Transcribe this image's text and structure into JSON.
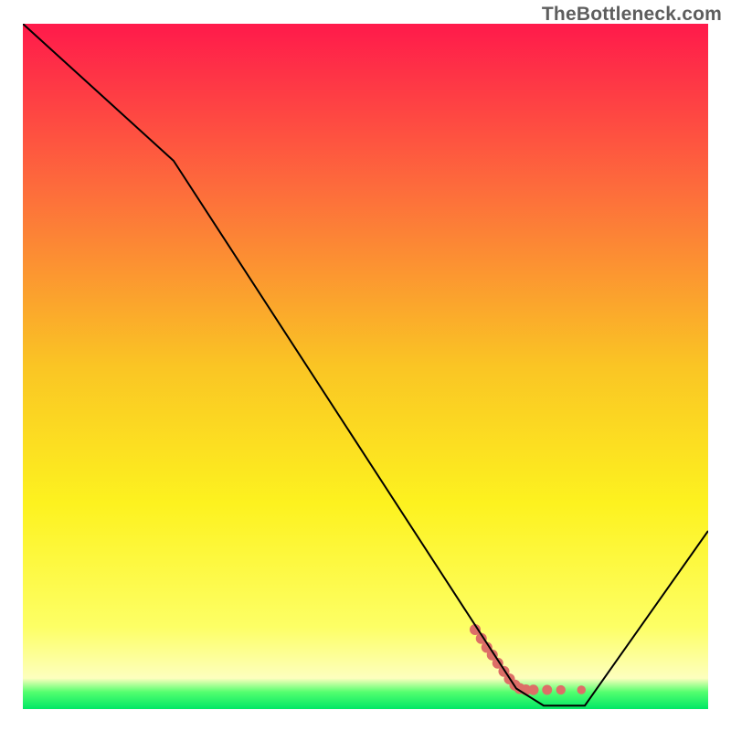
{
  "watermark": "TheBottleneck.com",
  "chart_data": {
    "type": "line",
    "title": "",
    "xlabel": "",
    "ylabel": "",
    "x_range": [
      0,
      100
    ],
    "y_range": [
      0,
      100
    ],
    "grid": false,
    "legend": false,
    "background_gradient": {
      "stops": [
        {
          "offset": 0.0,
          "color": "#ff1a4b"
        },
        {
          "offset": 0.25,
          "color": "#fd6f3b"
        },
        {
          "offset": 0.5,
          "color": "#fac524"
        },
        {
          "offset": 0.7,
          "color": "#fdf21f"
        },
        {
          "offset": 0.88,
          "color": "#fdff65"
        },
        {
          "offset": 0.955,
          "color": "#fdffbe"
        },
        {
          "offset": 0.975,
          "color": "#55ff6f"
        },
        {
          "offset": 1.0,
          "color": "#00e765"
        }
      ]
    },
    "series": [
      {
        "name": "bottleneck-curve",
        "x": [
          0,
          22,
          72,
          76,
          82,
          100
        ],
        "y": [
          100,
          80,
          3.0,
          0.5,
          0.5,
          26
        ],
        "stroke": "#000000",
        "width": 2
      }
    ],
    "markers": {
      "name": "highlight-cluster",
      "color": "#dd6e67",
      "points": [
        {
          "x": 66.0,
          "y": 11.6,
          "r": 4.3
        },
        {
          "x": 66.9,
          "y": 10.3,
          "r": 4.3
        },
        {
          "x": 67.7,
          "y": 9.0,
          "r": 4.3
        },
        {
          "x": 68.5,
          "y": 7.9,
          "r": 4.3
        },
        {
          "x": 69.3,
          "y": 6.7,
          "r": 4.3
        },
        {
          "x": 70.2,
          "y": 5.5,
          "r": 4.3
        },
        {
          "x": 71.0,
          "y": 4.4,
          "r": 4.3
        },
        {
          "x": 71.8,
          "y": 3.5,
          "r": 4.3
        },
        {
          "x": 72.5,
          "y": 3.0,
          "r": 4.3
        },
        {
          "x": 73.4,
          "y": 2.8,
          "r": 4.3
        },
        {
          "x": 74.5,
          "y": 2.8,
          "r": 4.1
        },
        {
          "x": 76.5,
          "y": 2.8,
          "r": 3.9
        },
        {
          "x": 78.5,
          "y": 2.8,
          "r": 3.7
        },
        {
          "x": 81.5,
          "y": 2.8,
          "r": 3.4
        }
      ]
    }
  }
}
